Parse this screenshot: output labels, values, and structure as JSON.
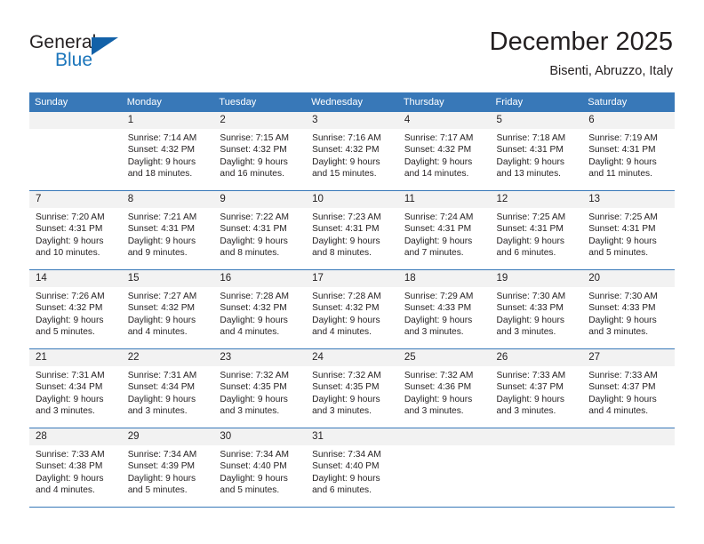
{
  "brand": {
    "name_part1": "General",
    "name_part2": "Blue",
    "triangle_icon": "triangle-icon"
  },
  "header": {
    "title": "December 2025",
    "subtitle": "Bisenti, Abruzzo, Italy"
  },
  "colors": {
    "header_blue": "#3878b8",
    "brand_blue": "#1b75bb",
    "daynum_band": "#f2f2f2",
    "text": "#231f20"
  },
  "weekday_headers": [
    "Sunday",
    "Monday",
    "Tuesday",
    "Wednesday",
    "Thursday",
    "Friday",
    "Saturday"
  ],
  "weeks": [
    [
      {
        "day": "",
        "lines": []
      },
      {
        "day": "1",
        "lines": [
          "Sunrise: 7:14 AM",
          "Sunset: 4:32 PM",
          "Daylight: 9 hours",
          "and 18 minutes."
        ]
      },
      {
        "day": "2",
        "lines": [
          "Sunrise: 7:15 AM",
          "Sunset: 4:32 PM",
          "Daylight: 9 hours",
          "and 16 minutes."
        ]
      },
      {
        "day": "3",
        "lines": [
          "Sunrise: 7:16 AM",
          "Sunset: 4:32 PM",
          "Daylight: 9 hours",
          "and 15 minutes."
        ]
      },
      {
        "day": "4",
        "lines": [
          "Sunrise: 7:17 AM",
          "Sunset: 4:32 PM",
          "Daylight: 9 hours",
          "and 14 minutes."
        ]
      },
      {
        "day": "5",
        "lines": [
          "Sunrise: 7:18 AM",
          "Sunset: 4:31 PM",
          "Daylight: 9 hours",
          "and 13 minutes."
        ]
      },
      {
        "day": "6",
        "lines": [
          "Sunrise: 7:19 AM",
          "Sunset: 4:31 PM",
          "Daylight: 9 hours",
          "and 11 minutes."
        ]
      }
    ],
    [
      {
        "day": "7",
        "lines": [
          "Sunrise: 7:20 AM",
          "Sunset: 4:31 PM",
          "Daylight: 9 hours",
          "and 10 minutes."
        ]
      },
      {
        "day": "8",
        "lines": [
          "Sunrise: 7:21 AM",
          "Sunset: 4:31 PM",
          "Daylight: 9 hours",
          "and 9 minutes."
        ]
      },
      {
        "day": "9",
        "lines": [
          "Sunrise: 7:22 AM",
          "Sunset: 4:31 PM",
          "Daylight: 9 hours",
          "and 8 minutes."
        ]
      },
      {
        "day": "10",
        "lines": [
          "Sunrise: 7:23 AM",
          "Sunset: 4:31 PM",
          "Daylight: 9 hours",
          "and 8 minutes."
        ]
      },
      {
        "day": "11",
        "lines": [
          "Sunrise: 7:24 AM",
          "Sunset: 4:31 PM",
          "Daylight: 9 hours",
          "and 7 minutes."
        ]
      },
      {
        "day": "12",
        "lines": [
          "Sunrise: 7:25 AM",
          "Sunset: 4:31 PM",
          "Daylight: 9 hours",
          "and 6 minutes."
        ]
      },
      {
        "day": "13",
        "lines": [
          "Sunrise: 7:25 AM",
          "Sunset: 4:31 PM",
          "Daylight: 9 hours",
          "and 5 minutes."
        ]
      }
    ],
    [
      {
        "day": "14",
        "lines": [
          "Sunrise: 7:26 AM",
          "Sunset: 4:32 PM",
          "Daylight: 9 hours",
          "and 5 minutes."
        ]
      },
      {
        "day": "15",
        "lines": [
          "Sunrise: 7:27 AM",
          "Sunset: 4:32 PM",
          "Daylight: 9 hours",
          "and 4 minutes."
        ]
      },
      {
        "day": "16",
        "lines": [
          "Sunrise: 7:28 AM",
          "Sunset: 4:32 PM",
          "Daylight: 9 hours",
          "and 4 minutes."
        ]
      },
      {
        "day": "17",
        "lines": [
          "Sunrise: 7:28 AM",
          "Sunset: 4:32 PM",
          "Daylight: 9 hours",
          "and 4 minutes."
        ]
      },
      {
        "day": "18",
        "lines": [
          "Sunrise: 7:29 AM",
          "Sunset: 4:33 PM",
          "Daylight: 9 hours",
          "and 3 minutes."
        ]
      },
      {
        "day": "19",
        "lines": [
          "Sunrise: 7:30 AM",
          "Sunset: 4:33 PM",
          "Daylight: 9 hours",
          "and 3 minutes."
        ]
      },
      {
        "day": "20",
        "lines": [
          "Sunrise: 7:30 AM",
          "Sunset: 4:33 PM",
          "Daylight: 9 hours",
          "and 3 minutes."
        ]
      }
    ],
    [
      {
        "day": "21",
        "lines": [
          "Sunrise: 7:31 AM",
          "Sunset: 4:34 PM",
          "Daylight: 9 hours",
          "and 3 minutes."
        ]
      },
      {
        "day": "22",
        "lines": [
          "Sunrise: 7:31 AM",
          "Sunset: 4:34 PM",
          "Daylight: 9 hours",
          "and 3 minutes."
        ]
      },
      {
        "day": "23",
        "lines": [
          "Sunrise: 7:32 AM",
          "Sunset: 4:35 PM",
          "Daylight: 9 hours",
          "and 3 minutes."
        ]
      },
      {
        "day": "24",
        "lines": [
          "Sunrise: 7:32 AM",
          "Sunset: 4:35 PM",
          "Daylight: 9 hours",
          "and 3 minutes."
        ]
      },
      {
        "day": "25",
        "lines": [
          "Sunrise: 7:32 AM",
          "Sunset: 4:36 PM",
          "Daylight: 9 hours",
          "and 3 minutes."
        ]
      },
      {
        "day": "26",
        "lines": [
          "Sunrise: 7:33 AM",
          "Sunset: 4:37 PM",
          "Daylight: 9 hours",
          "and 3 minutes."
        ]
      },
      {
        "day": "27",
        "lines": [
          "Sunrise: 7:33 AM",
          "Sunset: 4:37 PM",
          "Daylight: 9 hours",
          "and 4 minutes."
        ]
      }
    ],
    [
      {
        "day": "28",
        "lines": [
          "Sunrise: 7:33 AM",
          "Sunset: 4:38 PM",
          "Daylight: 9 hours",
          "and 4 minutes."
        ]
      },
      {
        "day": "29",
        "lines": [
          "Sunrise: 7:34 AM",
          "Sunset: 4:39 PM",
          "Daylight: 9 hours",
          "and 5 minutes."
        ]
      },
      {
        "day": "30",
        "lines": [
          "Sunrise: 7:34 AM",
          "Sunset: 4:40 PM",
          "Daylight: 9 hours",
          "and 5 minutes."
        ]
      },
      {
        "day": "31",
        "lines": [
          "Sunrise: 7:34 AM",
          "Sunset: 4:40 PM",
          "Daylight: 9 hours",
          "and 6 minutes."
        ]
      },
      {
        "day": "",
        "lines": []
      },
      {
        "day": "",
        "lines": []
      },
      {
        "day": "",
        "lines": []
      }
    ]
  ]
}
